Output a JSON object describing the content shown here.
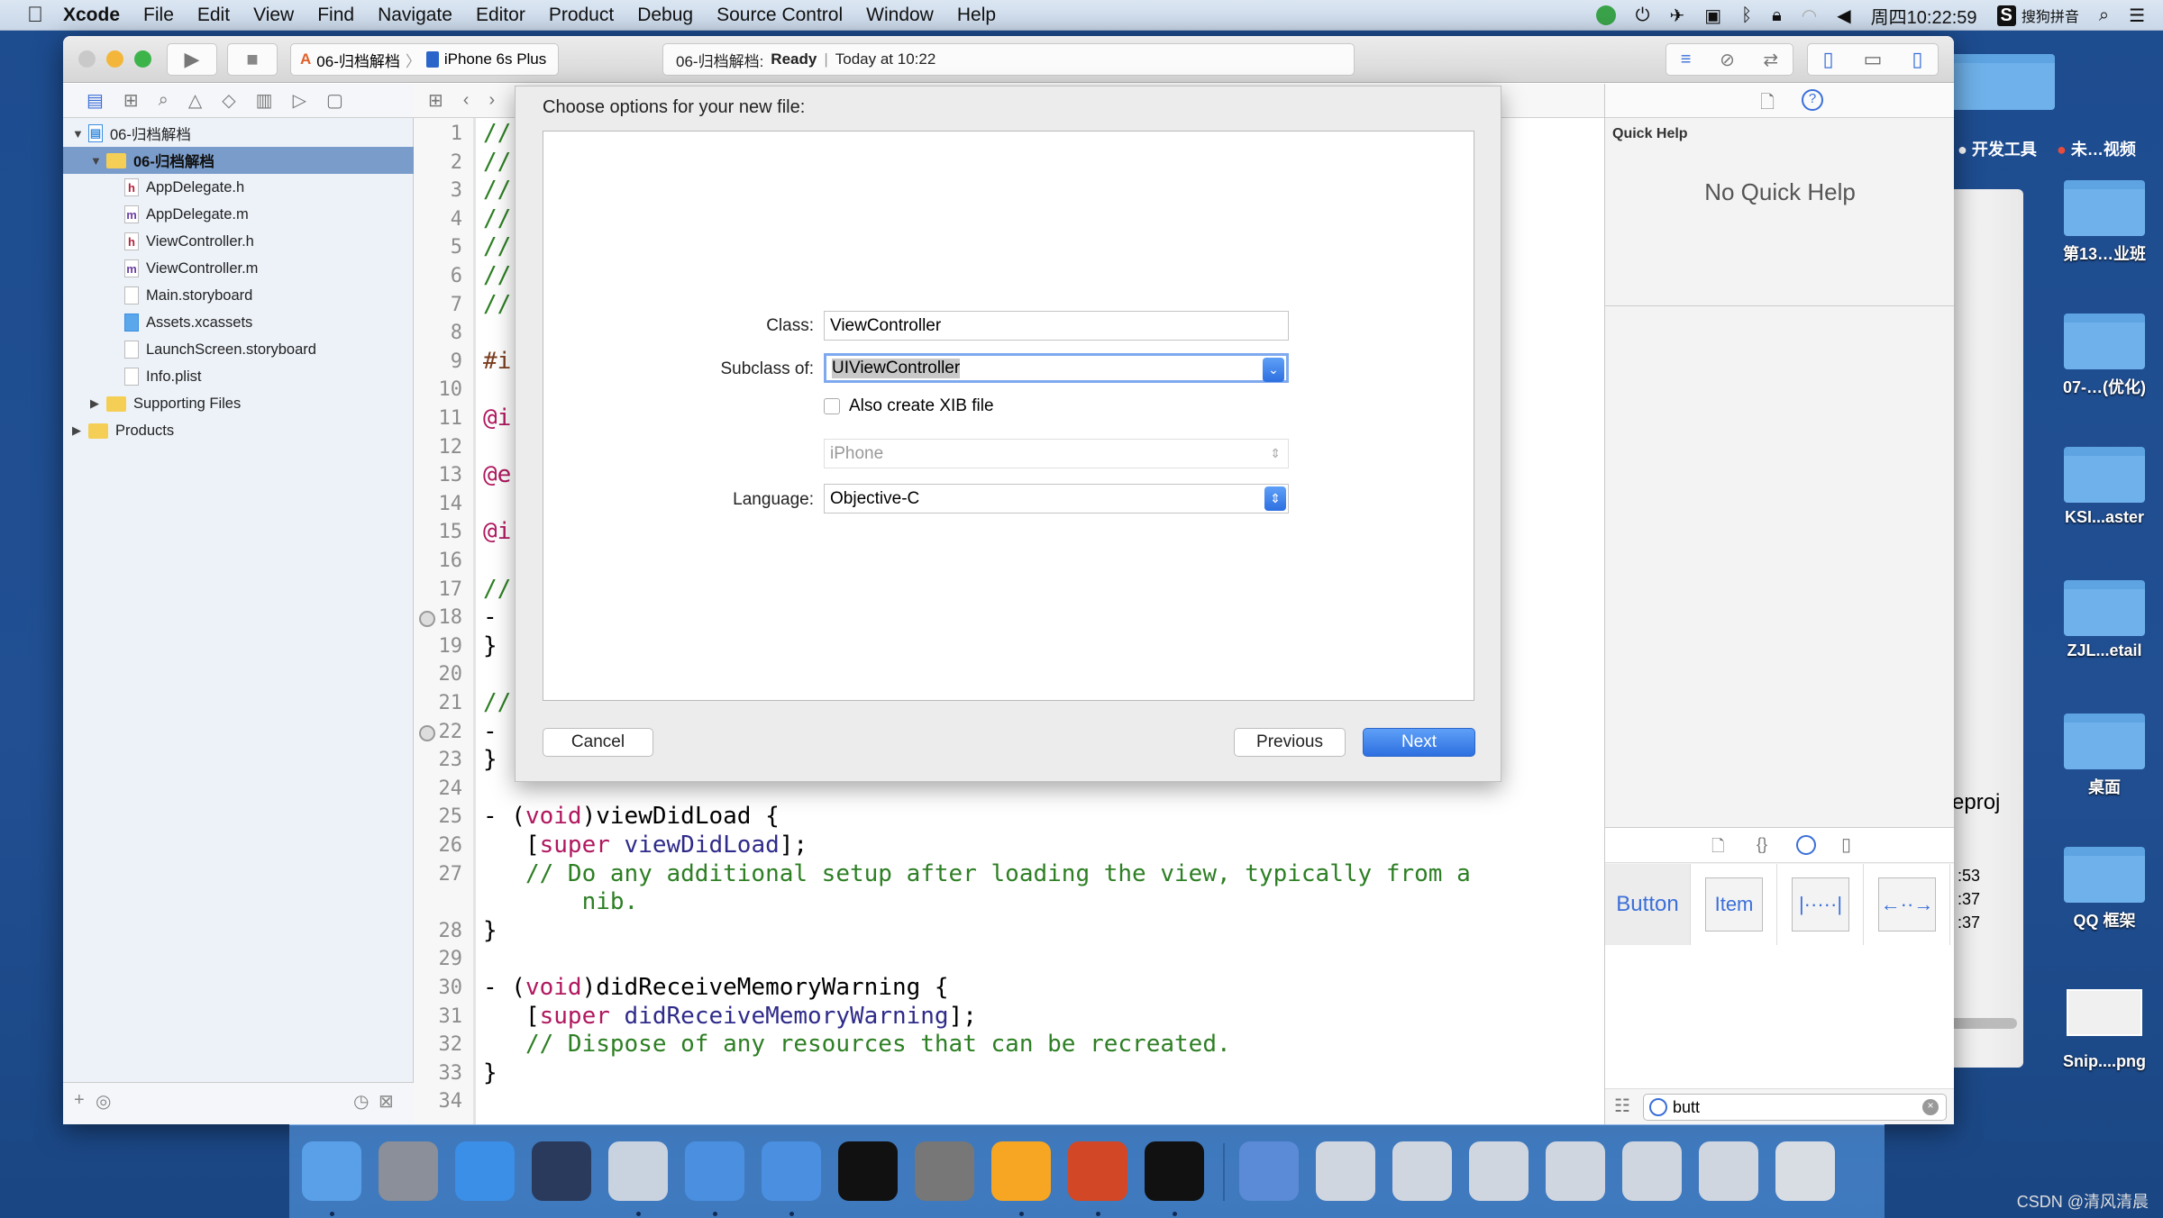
{
  "menubar": {
    "app": "Xcode",
    "items": [
      "File",
      "Edit",
      "View",
      "Find",
      "Navigate",
      "Editor",
      "Product",
      "Debug",
      "Source Control",
      "Window",
      "Help"
    ],
    "clock": "周四10:22:59",
    "input_method": "搜狗拼音"
  },
  "toolbar": {
    "scheme_project": "06-归档解档",
    "scheme_device": "iPhone 6s Plus",
    "activity_project": "06-归档解档:",
    "activity_status": "Ready",
    "activity_time": "Today at 10:22"
  },
  "navigator": {
    "items": [
      {
        "label": "06-归档解档",
        "type": "project"
      },
      {
        "label": "06-归档解档",
        "type": "group",
        "selected": true
      },
      {
        "label": "AppDelegate.h",
        "type": "h"
      },
      {
        "label": "AppDelegate.m",
        "type": "m"
      },
      {
        "label": "ViewController.h",
        "type": "h"
      },
      {
        "label": "ViewController.m",
        "type": "m"
      },
      {
        "label": "Main.storyboard",
        "type": "storyboard"
      },
      {
        "label": "Assets.xcassets",
        "type": "assets"
      },
      {
        "label": "LaunchScreen.storyboard",
        "type": "storyboard"
      },
      {
        "label": "Info.plist",
        "type": "plist"
      },
      {
        "label": "Supporting Files",
        "type": "group"
      },
      {
        "label": "Products",
        "type": "group"
      }
    ]
  },
  "editor": {
    "lines": [
      {
        "n": "1",
        "s": [
          [
            "cm",
            "//"
          ]
        ]
      },
      {
        "n": "2",
        "s": [
          [
            "cm",
            "//"
          ]
        ]
      },
      {
        "n": "3",
        "s": [
          [
            "cm",
            "//"
          ]
        ]
      },
      {
        "n": "4",
        "s": [
          [
            "cm",
            "//"
          ]
        ]
      },
      {
        "n": "5",
        "s": [
          [
            "cm",
            "//"
          ]
        ]
      },
      {
        "n": "6",
        "s": [
          [
            "cm",
            "//"
          ]
        ]
      },
      {
        "n": "7",
        "s": [
          [
            "cm",
            "//"
          ]
        ]
      },
      {
        "n": "8",
        "s": []
      },
      {
        "n": "9",
        "s": [
          [
            "pp",
            "#i"
          ]
        ]
      },
      {
        "n": "10",
        "s": []
      },
      {
        "n": "11",
        "s": [
          [
            "kw",
            "@i"
          ]
        ]
      },
      {
        "n": "12",
        "s": []
      },
      {
        "n": "13",
        "s": [
          [
            "kw",
            "@e"
          ]
        ]
      },
      {
        "n": "14",
        "s": []
      },
      {
        "n": "15",
        "s": [
          [
            "kw",
            "@i"
          ]
        ]
      },
      {
        "n": "16",
        "s": []
      },
      {
        "n": "17",
        "s": [
          [
            "cm",
            "//"
          ]
        ]
      },
      {
        "n": "18",
        "s": [
          [
            "",
            "-"
          ]
        ],
        "bp": true
      },
      {
        "n": "19",
        "s": [
          [
            "",
            "}"
          ]
        ]
      },
      {
        "n": "20",
        "s": []
      },
      {
        "n": "21",
        "s": [
          [
            "cm",
            "//"
          ]
        ]
      },
      {
        "n": "22",
        "s": [
          [
            "",
            "-"
          ]
        ],
        "bp": true
      },
      {
        "n": "23",
        "s": [
          [
            "",
            "}"
          ]
        ]
      },
      {
        "n": "24",
        "s": []
      },
      {
        "n": "25",
        "s": [
          [
            "",
            "- ("
          ],
          [
            "kw",
            "void"
          ],
          [
            "",
            ")viewDidLoad {"
          ]
        ]
      },
      {
        "n": "26",
        "s": [
          [
            "",
            "   ["
          ],
          [
            "kw",
            "super"
          ],
          [
            "fn",
            " viewDidLoad"
          ],
          [
            "",
            "];"
          ]
        ]
      },
      {
        "n": "27",
        "s": [
          [
            "cm",
            "   // Do any additional setup after loading the view, typically from a"
          ]
        ]
      },
      {
        "n": "",
        "s": [
          [
            "cm",
            "       nib."
          ]
        ]
      },
      {
        "n": "28",
        "s": [
          [
            "",
            "}"
          ]
        ]
      },
      {
        "n": "29",
        "s": []
      },
      {
        "n": "30",
        "s": [
          [
            "",
            "- ("
          ],
          [
            "kw",
            "void"
          ],
          [
            "",
            ")didReceiveMemoryWarning {"
          ]
        ]
      },
      {
        "n": "31",
        "s": [
          [
            "",
            "   ["
          ],
          [
            "kw",
            "super"
          ],
          [
            "fn",
            " didReceiveMemoryWarning"
          ],
          [
            "",
            "];"
          ]
        ]
      },
      {
        "n": "32",
        "s": [
          [
            "cm",
            "   // Dispose of any resources that can be recreated."
          ]
        ]
      },
      {
        "n": "33",
        "s": [
          [
            "",
            "}"
          ]
        ]
      },
      {
        "n": "34",
        "s": []
      }
    ]
  },
  "dialog": {
    "title": "Choose options for your new file:",
    "class_label": "Class:",
    "class_value": "ViewController",
    "subclass_label": "Subclass of:",
    "subclass_value": "UIViewController",
    "xib_label": "Also create XIB file",
    "xib_checked": false,
    "device_value": "iPhone",
    "language_label": "Language:",
    "language_value": "Objective-C",
    "cancel": "Cancel",
    "previous": "Previous",
    "next": "Next"
  },
  "inspector": {
    "quick_help_title": "Quick Help",
    "quick_help_empty": "No Quick Help"
  },
  "library": {
    "items": [
      "Button",
      "Item"
    ],
    "filter_value": "butt"
  },
  "behind_window": {
    "text": "eproj",
    "times": [
      ":53",
      ":37",
      ":37"
    ]
  },
  "desktop": {
    "items": [
      "开发工具",
      "未…视频",
      "第13…业班",
      "07-…(优化)",
      "KSI...aster",
      "ZJL...etail",
      "桌面",
      "QQ 框架",
      "Snip....png"
    ]
  },
  "dock": {
    "apps": [
      "finder",
      "launchpad",
      "safari",
      "mouse-app",
      "photo-booth",
      "xcode",
      "simulator",
      "terminal",
      "system-preferences",
      "sketch",
      "powerpoint",
      "console"
    ],
    "others": [
      "quicktime",
      "screenshot",
      "screenshot",
      "screenshot",
      "screenshot",
      "screenshot",
      "screenshot",
      "trash"
    ]
  },
  "watermark": "CSDN @清风清晨",
  "colors": {
    "accent": "#2d6fe0",
    "selection": "#7a9ccb",
    "comment": "#2d7f24",
    "keyword": "#b0185f"
  }
}
